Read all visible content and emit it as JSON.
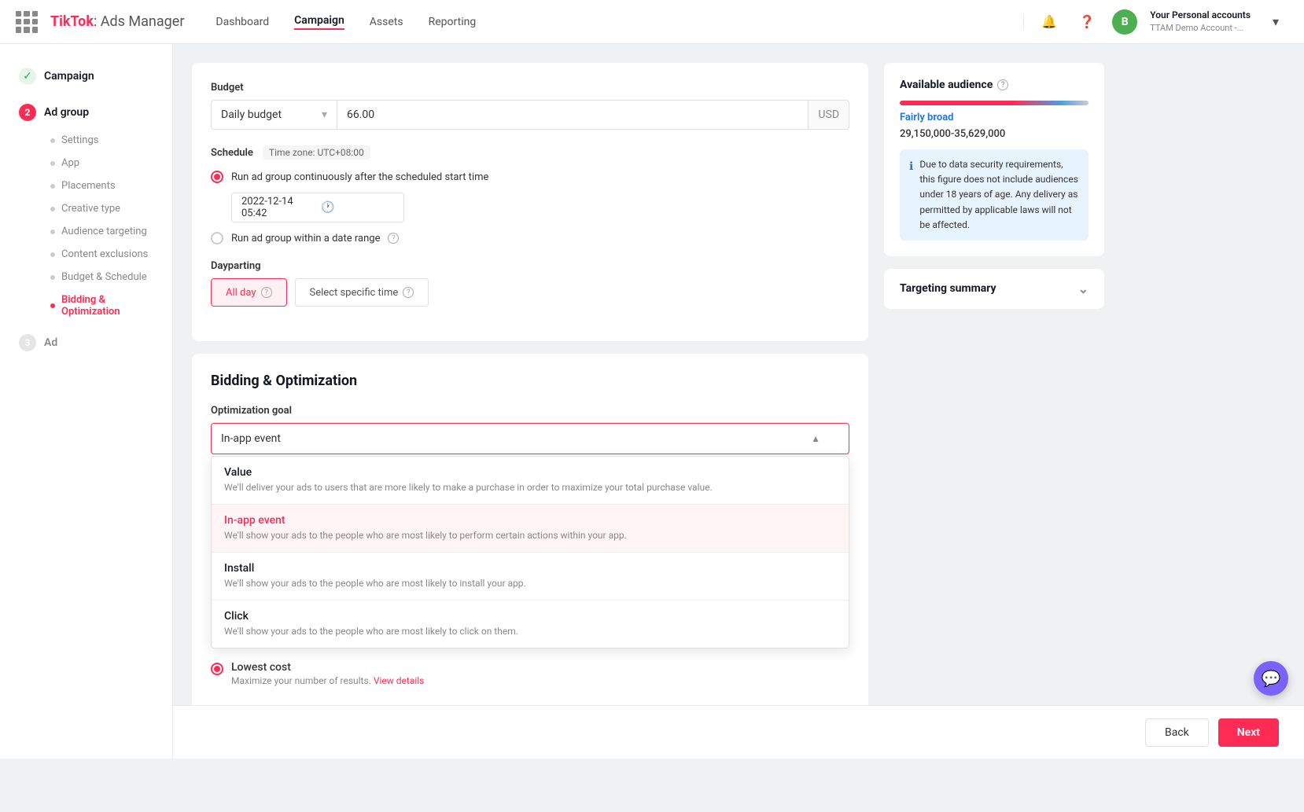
{
  "app": {
    "title": "TikTok Ads Manager",
    "brand": "TikTok",
    "brand_suffix": ": Ads Manager"
  },
  "topnav": {
    "links": [
      "Dashboard",
      "Campaign",
      "Assets",
      "Reporting"
    ],
    "active_link": "Campaign",
    "account_title": "Your Personal accounts",
    "account_sub": "TTAM Demo Account -..."
  },
  "sidebar": {
    "step1_label": "Campaign",
    "step2_label": "Ad group",
    "step2_num": "2",
    "step3_label": "Ad",
    "step3_num": "3",
    "sub_items": [
      {
        "label": "Settings",
        "active": false
      },
      {
        "label": "App",
        "active": false
      },
      {
        "label": "Placements",
        "active": false
      },
      {
        "label": "Creative type",
        "active": false
      },
      {
        "label": "Audience targeting",
        "active": false
      },
      {
        "label": "Content exclusions",
        "active": false
      },
      {
        "label": "Budget & Schedule",
        "active": false
      },
      {
        "label": "Bidding & Optimization",
        "active": true
      }
    ]
  },
  "budget": {
    "section_note": "",
    "type": "Daily budget",
    "amount": "66.00",
    "currency": "USD"
  },
  "schedule": {
    "label": "Schedule",
    "timezone": "Time zone: UTC+08:00",
    "option1": "Run ad group continuously after the scheduled start time",
    "option1_selected": true,
    "date_value": "2022-12-14 05:42",
    "option2": "Run ad group within a date range",
    "option2_selected": false
  },
  "dayparting": {
    "label": "Dayparting",
    "btn_allday": "All day",
    "btn_specific": "Select specific time",
    "allday_active": true
  },
  "bidding": {
    "section_title": "Bidding & Optimization",
    "optimization_goal_label": "Optimization goal",
    "selected_value": "In-app event",
    "dropdown_items": [
      {
        "title": "Value",
        "desc": "We'll deliver your ads to users that are more likely to make a purchase in order to maximize your total purchase value.",
        "selected": false,
        "title_color": "black"
      },
      {
        "title": "In-app event",
        "desc": "We'll show your ads to the people who are most likely to perform certain actions within your app.",
        "selected": true,
        "title_color": "pink"
      },
      {
        "title": "Install",
        "desc": "We'll show your ads to the people who are most likely to install your app.",
        "selected": false,
        "title_color": "black"
      },
      {
        "title": "Click",
        "desc": "We'll show your ads to the people who are most likely to click on them.",
        "selected": false,
        "title_color": "black"
      }
    ],
    "bid_label": "Lowest cost",
    "bid_desc": "Maximize your number of results.",
    "bid_link": "View details"
  },
  "audience_panel": {
    "title": "Available audience",
    "broad_label": "Fairly broad",
    "range": "29,150,000-35,629,000",
    "notice": "Due to data security requirements, this figure does not include audiences under 18 years of age. Any delivery as permitted by applicable laws will not be affected."
  },
  "targeting_panel": {
    "title": "Targeting summary"
  },
  "bottom_bar": {
    "back_label": "Back",
    "next_label": "Next"
  }
}
